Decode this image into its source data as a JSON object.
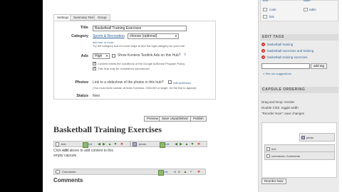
{
  "tabs": [
    "Settings",
    "Summary Text",
    "Group"
  ],
  "form": {
    "title_label": "Title",
    "title_value": "Basketball Training Exercises",
    "category_label": "Category",
    "category_value": "Sports & Recreation",
    "category_arrow": "→",
    "subcategory_value": "choose (optional)",
    "category_links": "add one   or more",
    "category_hint": "Try the category tool for more ways to find the right category for your hub",
    "ads_label": "Ads",
    "ads_value": "High",
    "ads_text": "Show Kontera Textlink Ads on this Hub?",
    "ads_help": "?",
    "check1_text": "Content meets the conditions of the Google AdSense Program Policy",
    "check2_text": "This Hub may be considered commercial",
    "photos_label": "Photos",
    "photos_text": "Link to a slideshow of the photos in this hub?",
    "photos_link": "edit slideshow",
    "photos_hint": "(You must must contain at least 5 photos, 200x150 or larger, for the link to appear)",
    "status_label": "Status",
    "status_value": "New"
  },
  "actions": {
    "preview": "Preview",
    "save": "Save Unpublished",
    "publish": "Publish"
  },
  "hub_title": "Basketball Training Exercises",
  "capsules": {
    "text_label": "text",
    "photo_label": "photo",
    "edit_label": "edit",
    "click_text_pre": "Click ",
    "click_text_bold": "edit",
    "click_text_post": " above to add content to this",
    "empty_capsule": "empty capsule.",
    "comments_label": "Comments",
    "comments_heading": "Comments"
  },
  "sidebar": {
    "top_links": [
      "text",
      "code",
      "link"
    ],
    "top_links_right": [
      "table",
      "table"
    ],
    "edit_tags_heading": "EDIT TAGS",
    "tags": [
      "basketball training",
      "basketball exercises and training",
      "basketball training exercises"
    ],
    "tag_button": "add tag",
    "suggestions_link": "See our suggestions",
    "capsule_ordering_heading": "CAPSULE ORDERING",
    "ordering_help": [
      "Drag and Drop: reorder",
      "Double Click: toggle width",
      "\"Reorder Now\": save changes"
    ],
    "order_photo": "photo",
    "order_text": "text",
    "order_comments": "comments: Comments",
    "reorder_button": "Reorder Now"
  }
}
